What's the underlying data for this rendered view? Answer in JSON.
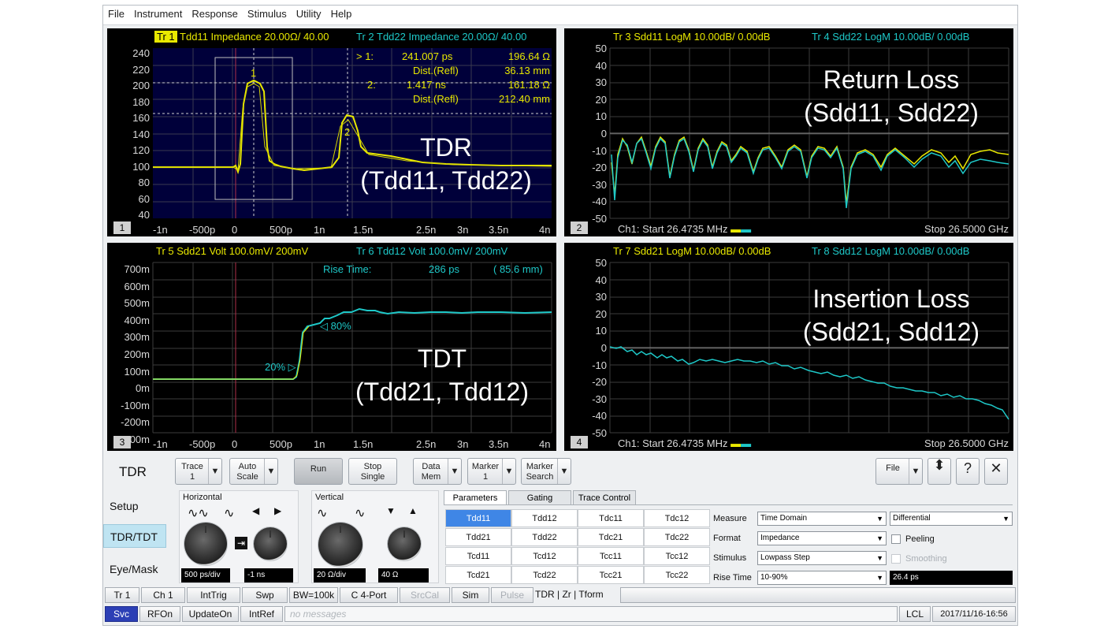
{
  "menu": [
    "File",
    "Instrument",
    "Response",
    "Stimulus",
    "Utility",
    "Help"
  ],
  "panels": {
    "p1": {
      "number": "1",
      "tr1_badge": "Tr 1",
      "tr1_text": "Tdd11 Impedance 20.00Ω/ 40.00",
      "tr2_text": "Tr 2  Tdd22 Impedance 20.00Ω/  40.00",
      "y_ticks": [
        "240",
        "220",
        "200",
        "180",
        "160",
        "140",
        "120",
        "100",
        "80",
        "60",
        "40"
      ],
      "x_ticks": [
        "-1n",
        "-500p",
        "0",
        "500p",
        "1n",
        "1.5n",
        "2.5n",
        "3n",
        "3.5n",
        "4n"
      ],
      "marker1": {
        "label": "> 1:",
        "time": "241.007  ps",
        "value": "196.64 Ω",
        "dist_label": "Dist.(Refl)",
        "dist": "36.13 mm"
      },
      "marker2": {
        "label": "2:",
        "time": "1.417  ns",
        "value": "161.18 Ω",
        "dist_label": "Dist.(Refl)",
        "dist": "212.40 mm"
      },
      "overlay_line1": "TDR",
      "overlay_line2": "(Tdd11, Tdd22)",
      "mk1": "1",
      "mk2": "2"
    },
    "p2": {
      "number": "2",
      "tr3_text": "Tr 3  Sdd11 LogM 10.00dB/  0.00dB",
      "tr4_text": "Tr 4  Sdd22 LogM 10.00dB/  0.00dB",
      "y_ticks": [
        "50",
        "40",
        "30",
        "20",
        "10",
        "0",
        "-10",
        "-20",
        "-30",
        "-40",
        "-50"
      ],
      "start": "Ch1:  Start  26.4735 MHz",
      "stop": "Stop  26.5000 GHz",
      "overlay_line1": "Return Loss",
      "overlay_line2": "(Sdd11, Sdd22)"
    },
    "p3": {
      "number": "3",
      "tr5_text": "Tr 5  Sdd21 Volt 100.0mV/  200mV",
      "tr6_text": "Tr 6  Tdd12 Volt 100.0mV/  200mV",
      "y_ticks": [
        "700m",
        "600m",
        "500m",
        "400m",
        "300m",
        "200m",
        "100m",
        "0m",
        "-100m",
        "-200m",
        "-300m"
      ],
      "x_ticks": [
        "-1n",
        "-500p",
        "0",
        "500p",
        "1n",
        "1.5n",
        "2.5n",
        "3n",
        "3.5n",
        "4n"
      ],
      "rise_label": "Rise Time:",
      "rise_value": "286 ps",
      "rise_dist": "( 85.6 mm)",
      "pct80": "◁ 80%",
      "pct20": "20% ▷",
      "overlay_line1": "TDT",
      "overlay_line2": "(Tdd21, Tdd12)"
    },
    "p4": {
      "number": "4",
      "tr7_text": "Tr 7  Sdd21 LogM 10.00dB/  0.00dB",
      "tr8_text": "Tr 8  Sdd12 LogM 10.00dB/  0.00dB",
      "y_ticks": [
        "50",
        "40",
        "30",
        "20",
        "10",
        "0",
        "-10",
        "-20",
        "-30",
        "-40",
        "-50"
      ],
      "start": "Ch1:  Start  26.4735 MHz",
      "stop": "Stop  26.5000 GHz",
      "overlay_line1": "Insertion Loss",
      "overlay_line2": "(Sdd21, Sdd12)"
    }
  },
  "toolbar": {
    "mode": "TDR",
    "trace_l1": "Trace",
    "trace_l2": "1",
    "auto_l1": "Auto",
    "auto_l2": "Scale",
    "run": "Run",
    "stop_l1": "Stop",
    "stop_l2": "Single",
    "data_l1": "Data",
    "data_l2": "Mem",
    "marker_l1": "Marker",
    "marker_l2": "1",
    "msearch_l1": "Marker",
    "msearch_l2": "Search",
    "file": "File",
    "updown": "⬍",
    "help": "?",
    "close": "✕",
    "dd": "▼"
  },
  "sidebar": [
    "Setup",
    "TDR/TDT",
    "Eye/Mask"
  ],
  "horizontal": {
    "title": "Horizontal",
    "value1": "500 ps/div",
    "value2": "-1 ns"
  },
  "vertical": {
    "title": "Vertical",
    "value1": "20 Ω/div",
    "value2": "40 Ω"
  },
  "tabs": [
    "Parameters",
    "Gating",
    "Trace Control"
  ],
  "param_grid": [
    [
      "Tdd11",
      "Tdd12",
      "Tdc11",
      "Tdc12"
    ],
    [
      "Tdd21",
      "Tdd22",
      "Tdc21",
      "Tdc22"
    ],
    [
      "Tcd11",
      "Tcd12",
      "Tcc11",
      "Tcc12"
    ],
    [
      "Tcd21",
      "Tcd22",
      "Tcc21",
      "Tcc22"
    ]
  ],
  "settings": {
    "measure_label": "Measure",
    "measure_value": "Time Domain",
    "mode_value": "Differential",
    "format_label": "Format",
    "format_value": "Impedance",
    "peeling": "Peeling",
    "stimulus_label": "Stimulus",
    "stimulus_value": "Lowpass Step",
    "smoothing": "Smoothing",
    "rise_label": "Rise Time",
    "rise_value": "10-90%",
    "rise_time": "26.4 ps"
  },
  "status1": [
    "Tr 1",
    "Ch 1",
    "IntTrig",
    "Swp",
    "BW=100k",
    "C  4-Port",
    "SrcCal",
    "Sim",
    "Pulse",
    "TDR | Zr | Tform"
  ],
  "status2": {
    "svc": "Svc",
    "rfon": "RFOn",
    "update": "UpdateOn",
    "intref": "IntRef",
    "messages": "no messages",
    "lcl": "LCL",
    "datetime": "2017/11/16-16:56"
  },
  "colors": {
    "trace_yellow": "#e8e800",
    "trace_cyan": "#1ec8c8",
    "grid": "#3c3c3c",
    "panel_bg": "#000000",
    "tdr_bg": "#00003a"
  }
}
